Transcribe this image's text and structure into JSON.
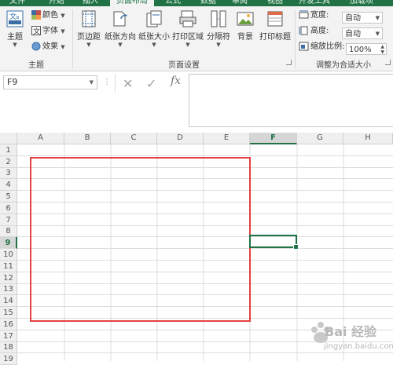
{
  "tabs": [
    "文件",
    "开始",
    "插入",
    "页面布局",
    "公式",
    "数据",
    "审阅",
    "视图",
    "开发工具",
    "加载项"
  ],
  "ribbon": {
    "theme_group": {
      "label": "主题",
      "theme_button": "主题",
      "colors": "颜色",
      "fonts": "字体",
      "effects": "效果"
    },
    "page_setup_group": {
      "label": "页面设置",
      "buttons": [
        "页边距",
        "纸张方向",
        "纸张大小",
        "打印区域",
        "分隔符",
        "背景",
        "打印标题"
      ]
    },
    "scale_group": {
      "label": "调整为合适大小",
      "width_label": "宽度:",
      "width_value": "自动",
      "height_label": "高度:",
      "height_value": "自动",
      "scale_label": "缩放比例:",
      "scale_value": "100%"
    }
  },
  "formula_bar": {
    "name_box": "F9",
    "cancel_symbol": "✕",
    "enter_symbol": "✓",
    "fx": "fx",
    "value": ""
  },
  "grid": {
    "columns": [
      "A",
      "B",
      "C",
      "D",
      "E",
      "F",
      "G",
      "H"
    ],
    "rows": [
      "1",
      "2",
      "3",
      "4",
      "5",
      "6",
      "7",
      "8",
      "9",
      "10",
      "11",
      "12",
      "13",
      "14",
      "15",
      "16",
      "17",
      "18",
      "19"
    ],
    "selected_column": "F",
    "selected_row": "9",
    "active_cell": "F9",
    "highlight_color": "#e4423f",
    "accent_color": "#217346"
  },
  "watermark": {
    "brand": "Bai 经验",
    "url": "jingyan.baidu.com"
  }
}
